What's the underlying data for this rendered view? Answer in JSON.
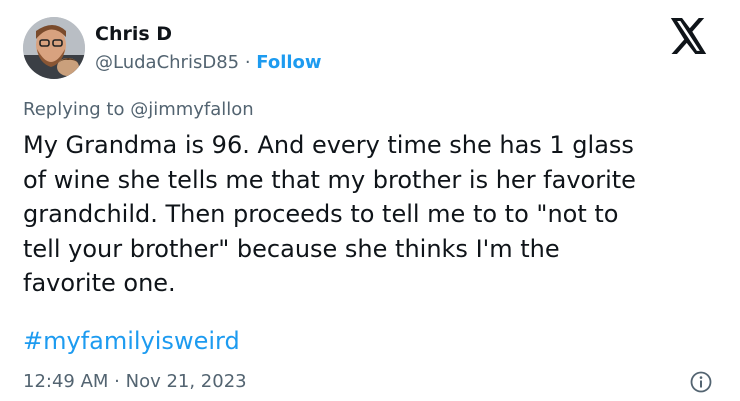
{
  "author": {
    "name": "Chris D",
    "handle": "@LudaChrisD85",
    "separator": " · ",
    "follow_label": "Follow",
    "avatar_icon": "profile-photo"
  },
  "platform_icon": "x-logo-icon",
  "reply": {
    "prefix": "Replying to ",
    "mention": "@jimmyfallon"
  },
  "tweet": {
    "text": "My Grandma is 96. And every time she has 1 glass\nof wine she tells me that my brother is her favorite\ngrandchild. Then proceeds to tell me to to \"not to\ntell your brother\" because she thinks I'm the\nfavorite one.",
    "hashtag": "#myfamilyisweird",
    "timestamp": "12:49 AM · Nov 21, 2023"
  },
  "colors": {
    "accent": "#1d9bf0",
    "text": "#0f1419",
    "secondary": "#536471"
  },
  "info_icon": "info-icon"
}
